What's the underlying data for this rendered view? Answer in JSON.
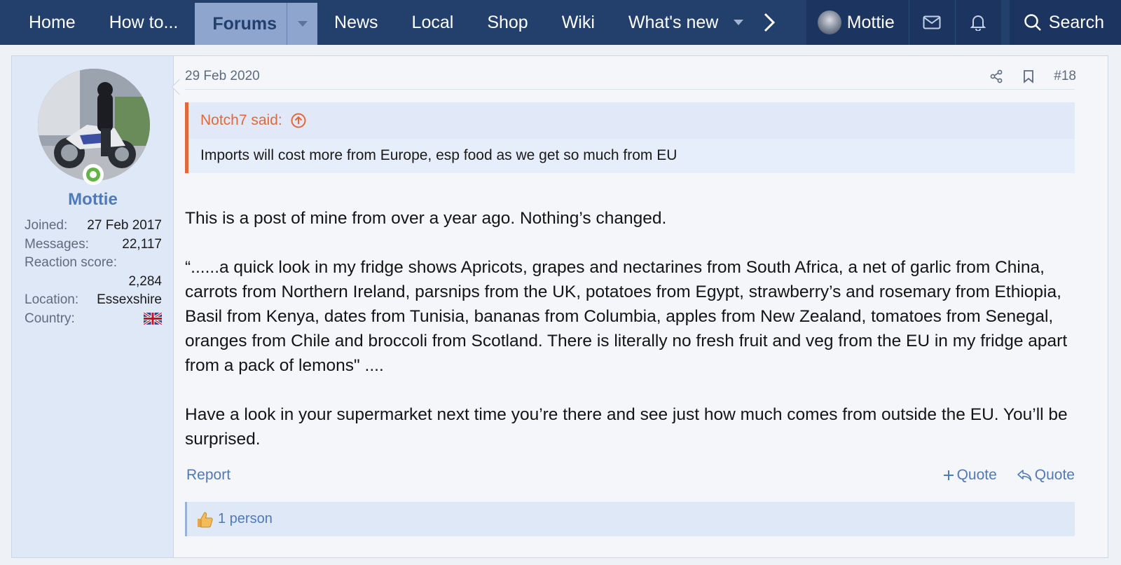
{
  "nav": {
    "items": [
      "Home",
      "How to...",
      "Forums",
      "News",
      "Local",
      "Shop",
      "Wiki",
      "What's new"
    ],
    "user": "Mottie",
    "search": "Search"
  },
  "post": {
    "date": "29 Feb 2020",
    "number": "#18",
    "author": {
      "name": "Mottie",
      "joined_label": "Joined:",
      "joined": "27 Feb 2017",
      "messages_label": "Messages:",
      "messages": "22,117",
      "reaction_label": "Reaction score:",
      "reaction": "2,284",
      "location_label": "Location:",
      "location": "Essexshire",
      "country_label": "Country:"
    },
    "quote": {
      "author": "Notch7 said:",
      "text": "Imports will cost more from Europe, esp food as we get so much from EU"
    },
    "message": [
      "This is a post of mine from over a year ago. Nothing’s changed.",
      "“......a quick look in my fridge shows Apricots, grapes and nectarines from South Africa, a net of garlic from China, carrots from Northern Ireland, parsnips from the UK, potatoes from Egypt, strawberry’s and rosemary from Ethiopia, Basil from Kenya, dates from Tunisia, bananas from Columbia, apples from New Zealand, tomatoes from Senegal, oranges from Chile and broccoli from Scotland. There is literally no fresh fruit and veg from the EU in my fridge apart from a pack of lemons\" ....",
      "Have a look in your supermarket next time you’re there and see just how much comes from outside the EU. You’ll be surprised."
    ],
    "footer": {
      "report": "Report",
      "multiquote": "Quote",
      "reply": "Quote"
    },
    "reactions": "1 person"
  }
}
